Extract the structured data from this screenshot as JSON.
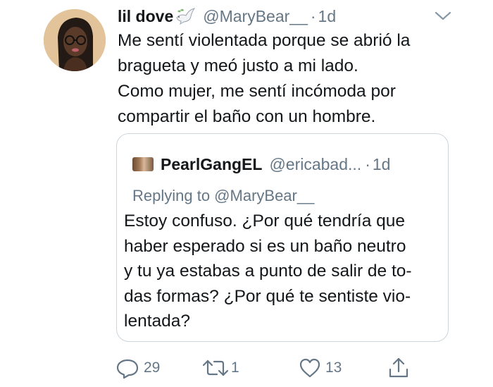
{
  "tweet": {
    "display_name": "lil dove",
    "handle": "@MaryBear__",
    "separator": "·",
    "time": "1d",
    "text_lines": [
      "Me sentí violentada porque se abrió la",
      "bragueta y meó justo a mi lado.",
      "Como mujer, me sentí incómoda por",
      "compartir el baño con un hombre."
    ]
  },
  "quoted": {
    "display_name": "PearlGangEL",
    "handle": "@ericabad...",
    "separator": "·",
    "time": "1d",
    "reply_context": "Replying to @MaryBear__",
    "text_lines": [
      "Estoy confuso. ¿Por qué tendría que",
      "haber esperado si es un baño neutro",
      "y tu ya estabas a punto de salir de to-",
      "das formas? ¿Por qué te sentiste vio-",
      "lentada?"
    ]
  },
  "actions": {
    "reply_count": "29",
    "retweet_count": "1",
    "like_count": "13"
  },
  "icons": {
    "name_emoji": "dove-icon",
    "menu": "chevron-down-icon",
    "reply": "reply-icon",
    "retweet": "retweet-icon",
    "like": "heart-icon",
    "share": "share-icon"
  },
  "colors": {
    "text": "#14171a",
    "secondary": "#657786",
    "border": "#ccd6dd"
  }
}
